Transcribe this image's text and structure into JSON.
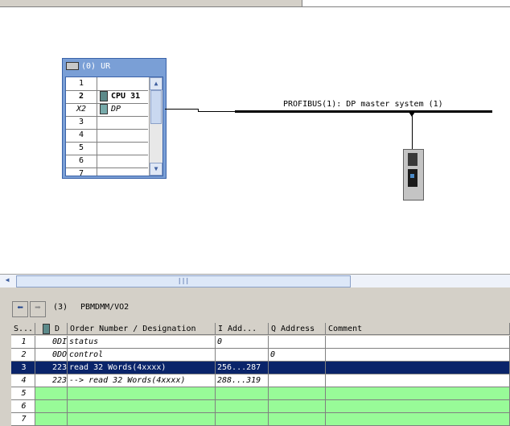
{
  "rack": {
    "title": "(0) UR",
    "slots": [
      {
        "slot": "1",
        "module": ""
      },
      {
        "slot": "2",
        "module": "CPU 31"
      },
      {
        "slot": "X2",
        "module": "DP"
      },
      {
        "slot": "3",
        "module": ""
      },
      {
        "slot": "4",
        "module": ""
      },
      {
        "slot": "5",
        "module": ""
      },
      {
        "slot": "6",
        "module": ""
      },
      {
        "slot": "7",
        "module": ""
      }
    ]
  },
  "bus": {
    "label": "PROFIBUS(1): DP master system (1)"
  },
  "detail": {
    "module_number": "(3)",
    "module_name": "PBMDMM/VO2",
    "headers": [
      "S...",
      "D",
      "Order Number / Designation",
      "I Add...",
      "Q Address",
      "Comment"
    ],
    "rows": [
      {
        "s": "1",
        "d": "0DI",
        "designation": "status",
        "iaddr": "0",
        "qaddr": "",
        "comment": ""
      },
      {
        "s": "2",
        "d": "0DO",
        "designation": "control",
        "iaddr": "",
        "qaddr": "0",
        "comment": ""
      },
      {
        "s": "3",
        "d": "223",
        "designation": "read 32 Words(4xxxx)",
        "iaddr": "256...287",
        "qaddr": "",
        "comment": ""
      },
      {
        "s": "4",
        "d": "223",
        "designation": "--> read 32 Words(4xxxx)",
        "iaddr": "288...319",
        "qaddr": "",
        "comment": ""
      },
      {
        "s": "5",
        "d": "",
        "designation": "",
        "iaddr": "",
        "qaddr": "",
        "comment": ""
      },
      {
        "s": "6",
        "d": "",
        "designation": "",
        "iaddr": "",
        "qaddr": "",
        "comment": ""
      },
      {
        "s": "7",
        "d": "",
        "designation": "",
        "iaddr": "",
        "qaddr": "",
        "comment": ""
      }
    ]
  },
  "colors": {
    "selection": "#0a246a",
    "empty_slot": "#98fb98",
    "rack_frame": "#7a9fd6"
  }
}
